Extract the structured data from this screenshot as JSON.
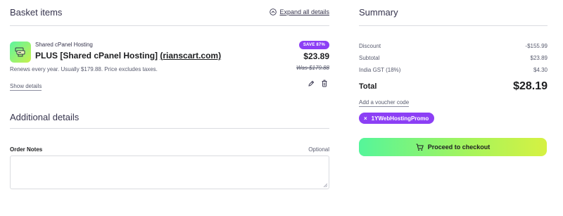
{
  "basket": {
    "title": "Basket items",
    "expand_label": "Expand all details"
  },
  "item": {
    "category": "Shared cPanel Hosting",
    "name_prefix": "PLUS [Shared cPanel Hosting] ",
    "name_domain": "(rianscart.com)",
    "renew_text": "Renews every year. Usually $179.88. Price excludes taxes.",
    "show_details": "Show details",
    "save_badge": "SAVE 87%",
    "price": "$23.89",
    "old_price": "Was $179.88"
  },
  "additional": {
    "title": "Additional details",
    "notes_label": "Order Notes",
    "notes_optional": "Optional",
    "notes_value": ""
  },
  "summary": {
    "title": "Summary",
    "rows": [
      {
        "label": "Discount",
        "value": "-$155.99"
      },
      {
        "label": "Subtotal",
        "value": "$23.89"
      },
      {
        "label": "India GST (18%)",
        "value": "$4.30"
      }
    ],
    "total_label": "Total",
    "total_value": "$28.19",
    "voucher_link": "Add a voucher code",
    "promo_code": "1YWebHostingPromo",
    "promo_close": "×",
    "checkout_label": "Proceed to checkout"
  },
  "colors": {
    "accent_purple": "#8c3ff5",
    "gradient_start": "#55f59a",
    "gradient_end": "#d6f142"
  }
}
